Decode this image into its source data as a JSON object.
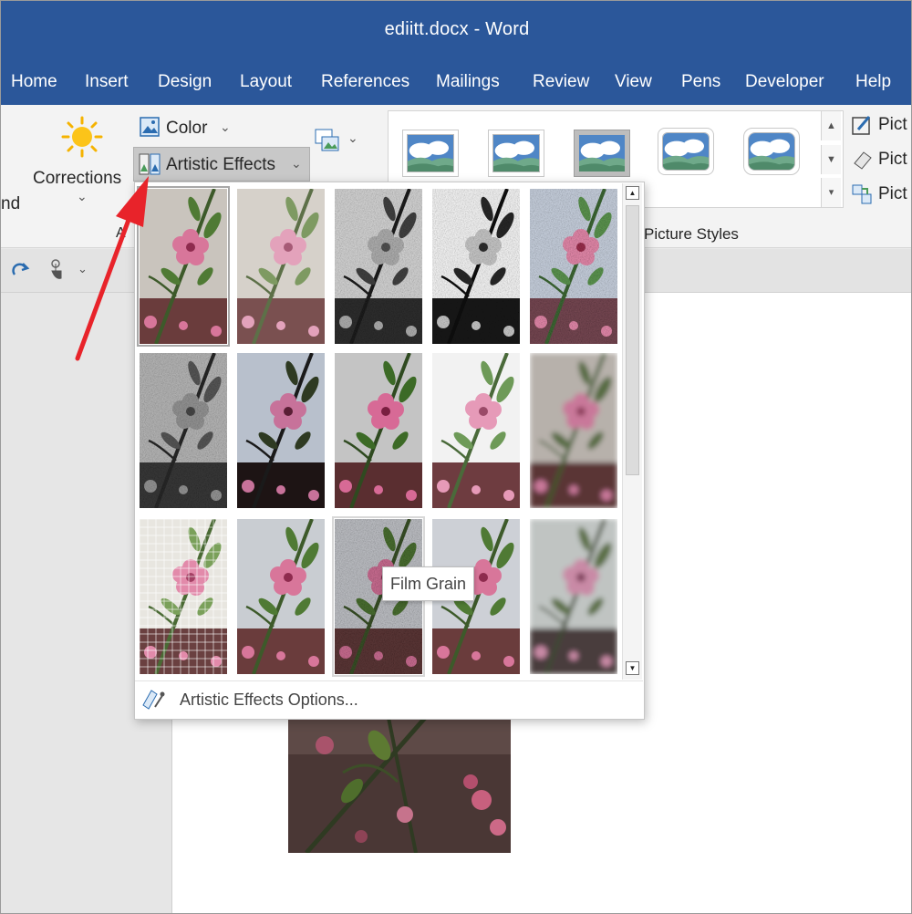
{
  "window": {
    "title": "ediitt.docx  -  Word"
  },
  "menu": {
    "tabs": [
      "Home",
      "Insert",
      "Design",
      "Layout",
      "References",
      "Mailings",
      "Review",
      "View",
      "Pens",
      "Developer",
      "Help"
    ]
  },
  "ribbon": {
    "left_cut_label": "nd",
    "corrections_label": "Corrections",
    "corrections_caret": "⌄",
    "color_label": "Color",
    "color_caret": "⌄",
    "artistic_effects_label": "Artistic Effects",
    "artistic_effects_caret": "⌄",
    "group_cut_label": "A",
    "picture_styles_label": "Picture Styles",
    "right_items": [
      "Pict",
      "Pict",
      "Pict"
    ]
  },
  "gallery": {
    "selected_index": 0,
    "hovered_index": 12,
    "tooltip": "Film Grain",
    "options_label": "Artistic Effects Options...",
    "effects": [
      "none",
      "washed",
      "pencil",
      "lineart",
      "chalk",
      "gray",
      "dark",
      "cutout",
      "glow",
      "blur",
      "mosaic",
      "light",
      "grain",
      "light2",
      "glass"
    ]
  },
  "colors": {
    "accent": "#2b579a",
    "arrow": "#e8232a"
  }
}
